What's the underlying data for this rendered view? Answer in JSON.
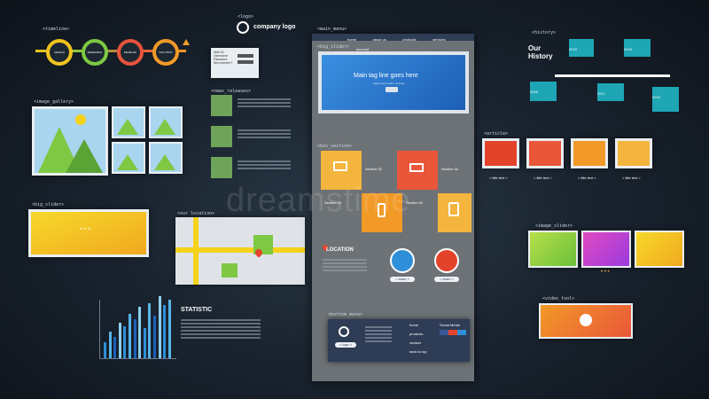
{
  "watermark": "dreamstime",
  "timeline": {
    "tag": "<timeline>",
    "steps": [
      "DESIGN",
      "RESEARCH",
      "DEVELOP",
      "SOLUTION"
    ],
    "colors": [
      "#f0c31e",
      "#7ec843",
      "#e6533b",
      "#f29a27"
    ]
  },
  "logo": {
    "tag": "<logo>",
    "text": "company logo"
  },
  "login": {
    "fields": [
      "Web ID",
      "Username",
      "Password",
      "Not member?"
    ]
  },
  "image_gallery": {
    "tag": "<image_gallery>"
  },
  "news_releases": {
    "tag": "<news_releases>"
  },
  "big_slider": {
    "tag": "<big_slider>",
    "arrows": "< • >"
  },
  "location": {
    "tag": "<our location>"
  },
  "statistic": {
    "title": "STATISTIC"
  },
  "site": {
    "nav_tag": "<main_menu>",
    "menu": [
      "home",
      "about us",
      "products",
      "services"
    ],
    "account": "account",
    "slider_tag": "<big_slider>",
    "hero_text": "Main tag line goes here",
    "hero_sub": "Ipsum lorem dolor sit amet",
    "box_tag": "<box_section>",
    "sections": [
      "Section 01",
      "Section 02",
      "Section 03",
      "Section 04",
      "Section 05"
    ],
    "location": "LOCATION",
    "team": "< team >",
    "bottom_tag": "<bottom_menu>",
    "footer_logo": "< logo >",
    "footer_links": [
      "home",
      "products",
      "contact",
      "back to top"
    ],
    "social": "Social Media"
  },
  "history": {
    "tag": "<history>",
    "title": "Our History",
    "years": [
      "2015",
      "2016",
      "2017",
      "2018",
      "2019"
    ]
  },
  "article": {
    "tag": "<article>",
    "title": "< title text >",
    "colors": [
      "#e3432b",
      "#e9563a",
      "#f29a27",
      "#f3b53d"
    ]
  },
  "image_slider": {
    "tag": "<image_slider>",
    "dots": "• • •"
  },
  "video_tag": "<video_tool>",
  "stat_bars": [
    18,
    30,
    24,
    40,
    36,
    50,
    44,
    58,
    34,
    62,
    48,
    70,
    60,
    66
  ]
}
